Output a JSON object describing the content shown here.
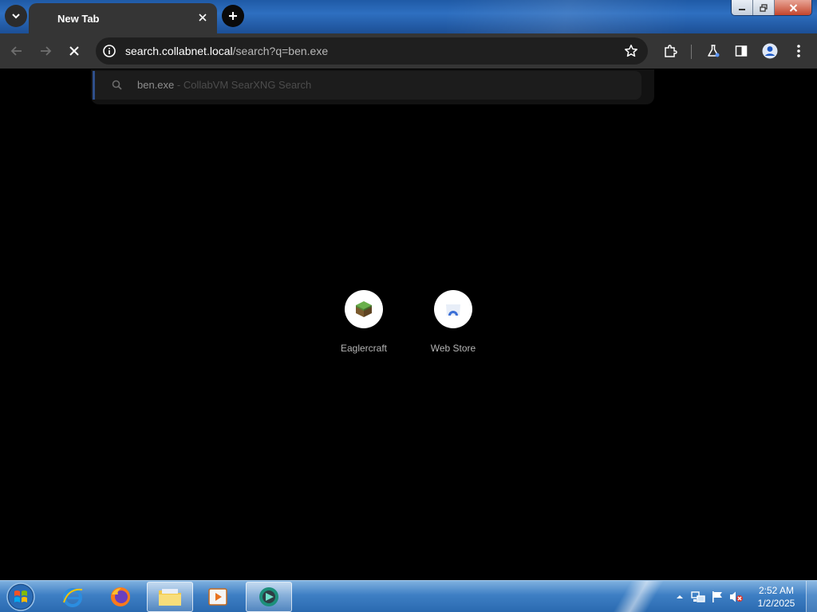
{
  "browser": {
    "tab": {
      "title": "New Tab"
    },
    "omnibox": {
      "url_host": "search.collabnet.local",
      "url_path": "/search?q=ben.exe"
    },
    "suggestion": {
      "query": "ben.exe",
      "separator": " - ",
      "engine": "CollabVM SearXNG Search"
    }
  },
  "shortcuts": [
    {
      "label": "Eaglercraft",
      "icon": "grass-block-icon"
    },
    {
      "label": "Web Store",
      "icon": "web-store-icon"
    }
  ],
  "taskbar": {
    "apps": [
      "internet-explorer-icon",
      "firefox-icon",
      "file-explorer-icon",
      "media-player-icon",
      "chromium-icon"
    ],
    "clock": {
      "time": "2:52 AM",
      "date": "1/2/2025"
    }
  },
  "colors": {
    "accent": "#2f4f8a",
    "toolbar": "#353535",
    "omnibox": "#1f1f1f"
  }
}
